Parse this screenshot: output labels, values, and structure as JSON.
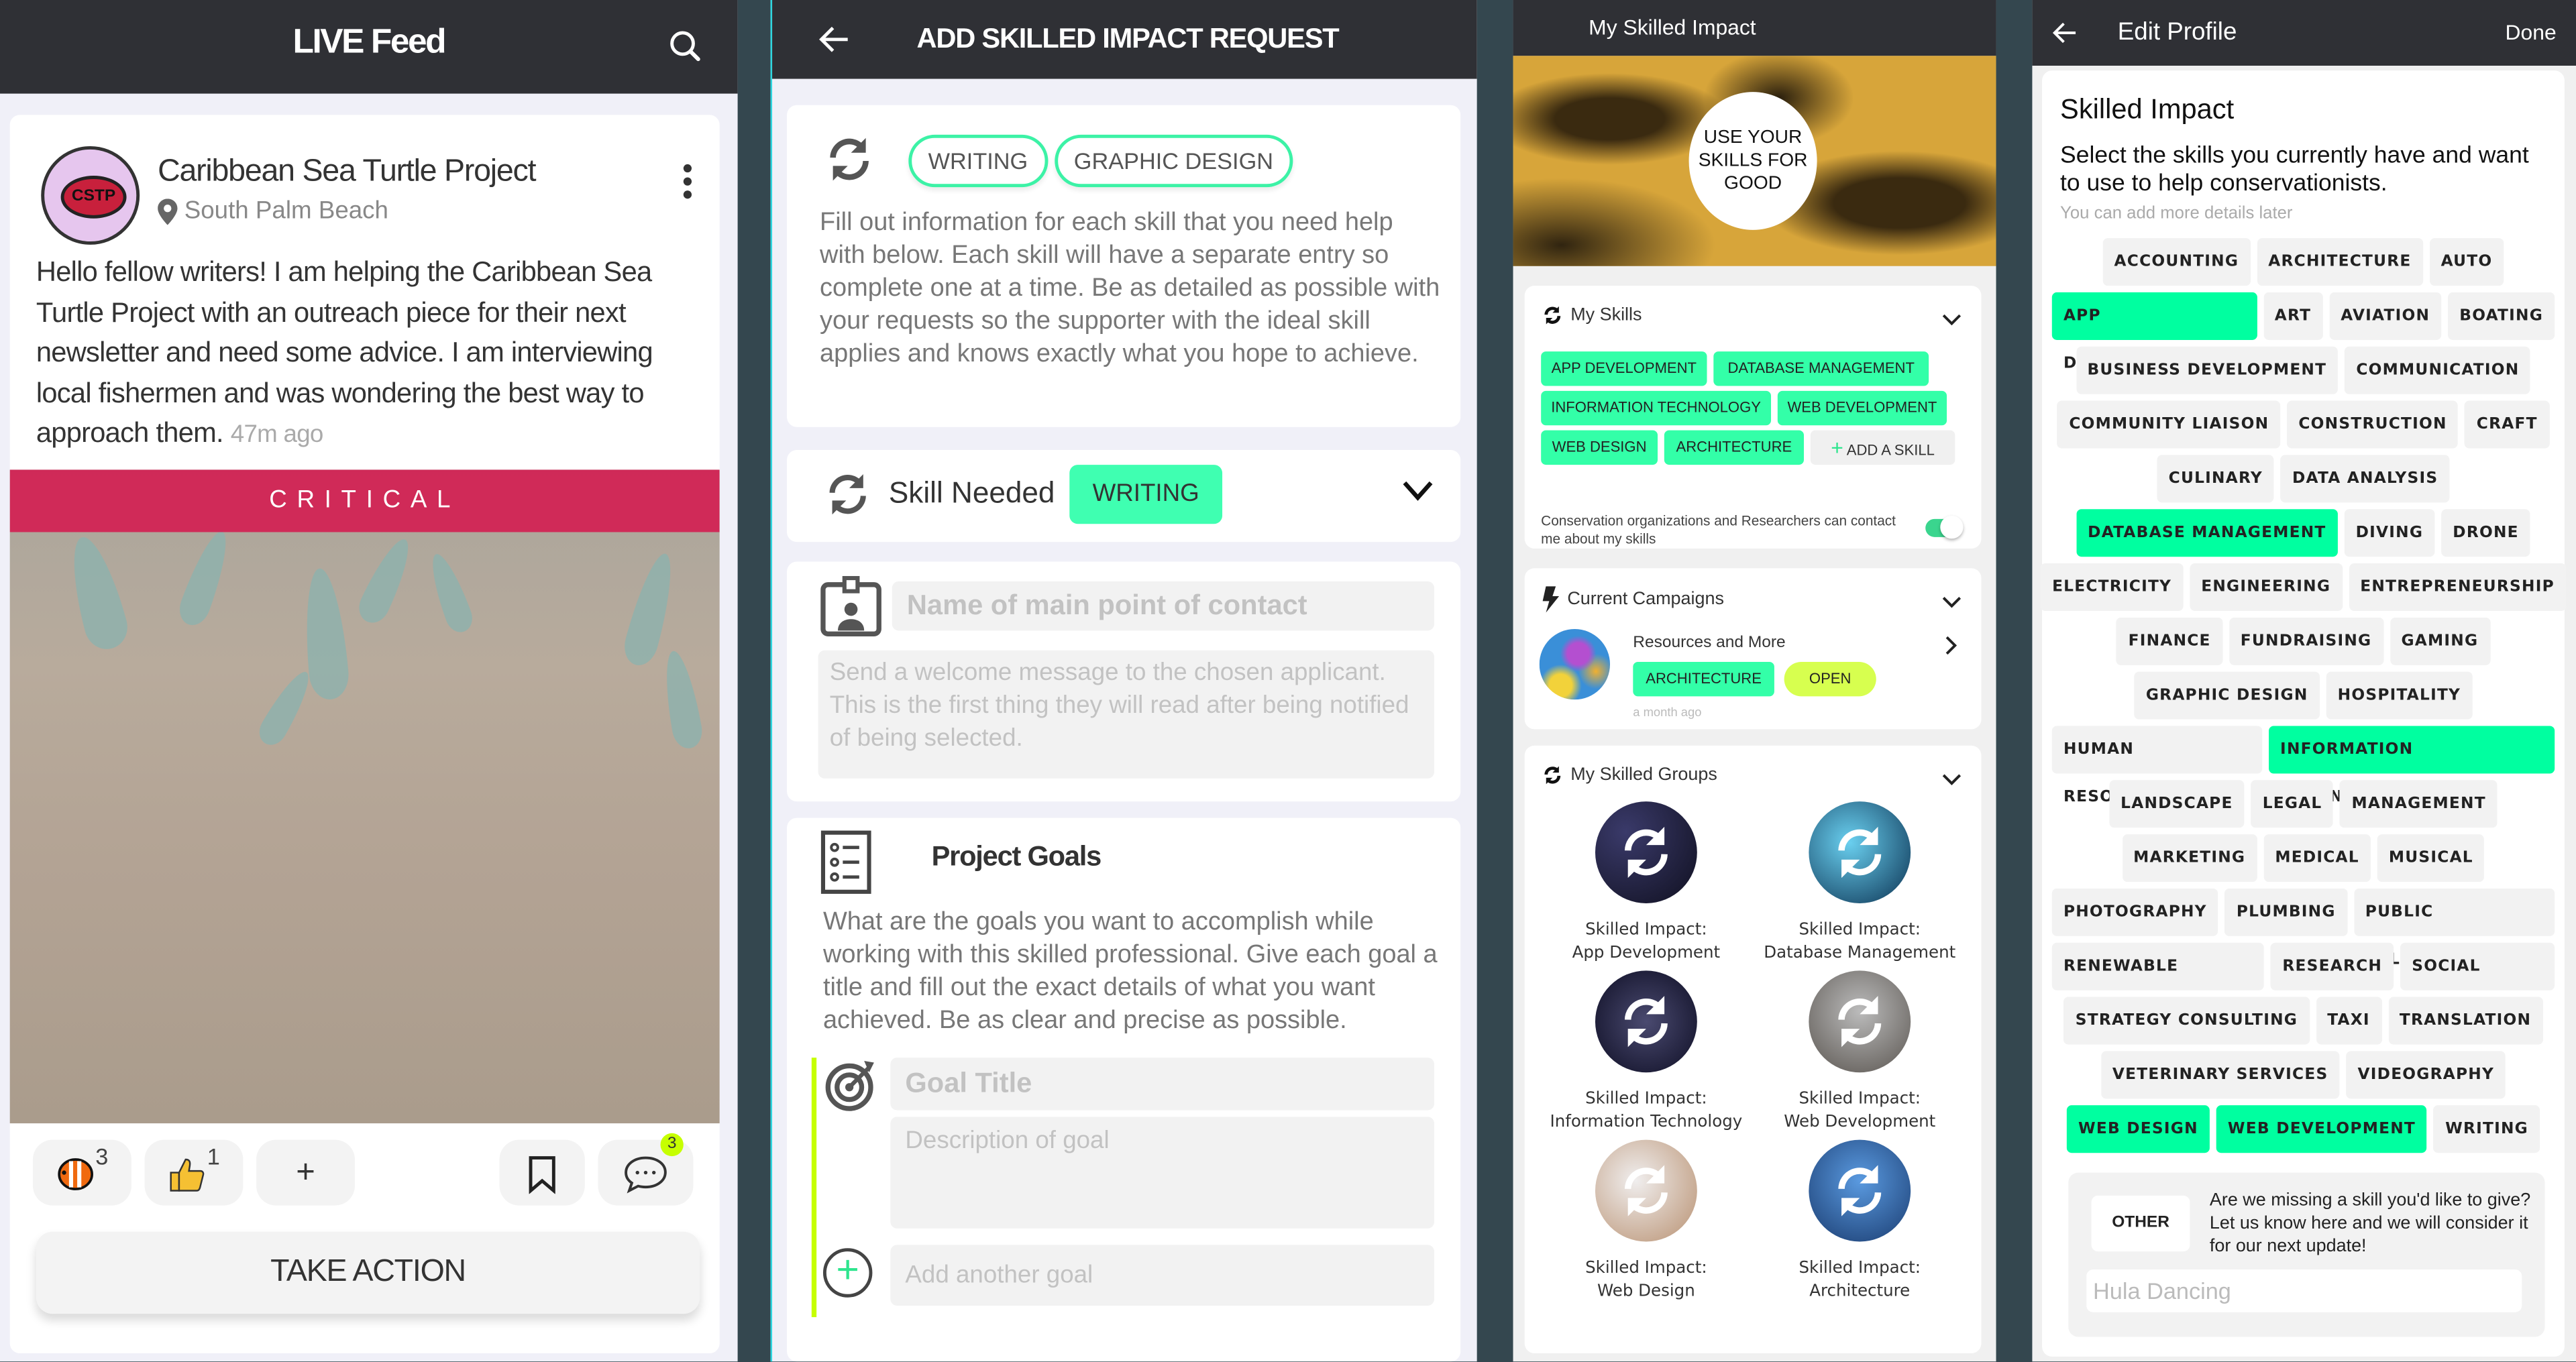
{
  "feed": {
    "title": "LIVE Feed",
    "post": {
      "org_name": "Caribbean Sea Turtle Project",
      "avatar_text": "CSTP",
      "location": "South Palm Beach",
      "body": "Hello fellow writers! I am helping the Caribbean Sea Turtle Project with an outreach piece for their next newsletter and need some advice. I am interviewing local fishermen and was wondering the best way to approach them.",
      "time_ago": "47m ago",
      "banner": "CRITICAL",
      "reactions": [
        {
          "icon": "clownfish-icon",
          "count": "3"
        },
        {
          "icon": "thumbs-up-icon",
          "count": "1"
        }
      ],
      "add_reaction": "+",
      "comment_count": "3",
      "action_button": "TAKE ACTION"
    }
  },
  "request": {
    "title": "ADD SKILLED IMPACT REQUEST",
    "selected_skills": [
      "WRITING",
      "GRAPHIC DESIGN"
    ],
    "intro": "Fill out information for each skill that you need help with below. Each skill will have a separate entry so complete one at a time. Be as detailed as possible with your requests so the supporter with the ideal skill applies and knows exactly what you hope to achieve.",
    "skill_needed_label": "Skill Needed",
    "skill_needed_value": "WRITING",
    "contact_placeholder": "Name of main point of contact",
    "welcome_placeholder": "Send a welcome message to the chosen applicant. This is the first thing they will read after being notified of being selected.",
    "goals_title": "Project Goals",
    "goals_desc": "What are the goals you want to accomplish while working with this skilled professional. Give each goal a title and fill out the exact details of what you want achieved. Be as clear and precise as possible.",
    "goal_title_placeholder": "Goal Title",
    "goal_desc_placeholder": "Description of goal",
    "add_goal_placeholder": "Add another goal"
  },
  "my_impact": {
    "title": "My Skilled Impact",
    "hero_text": "USE YOUR SKILLS FOR GOOD",
    "my_skills_title": "My Skills",
    "skills": [
      "APP DEVELOPMENT",
      "DATABASE MANAGEMENT",
      "INFORMATION TECHNOLOGY",
      "WEB DEVELOPMENT",
      "WEB DESIGN",
      "ARCHITECTURE"
    ],
    "add_skill": "ADD A SKILL",
    "contact_toggle_label": "Conservation organizations and Researchers can contact me about my skills",
    "contact_toggle_on": true,
    "campaigns_title": "Current Campaigns",
    "campaign": {
      "name": "Resources and More",
      "skill": "ARCHITECTURE",
      "status": "OPEN",
      "time_ago": "a month ago"
    },
    "groups_title": "My Skilled Groups",
    "groups": [
      {
        "line1": "Skilled Impact:",
        "line2": "App Development"
      },
      {
        "line1": "Skilled Impact:",
        "line2": "Database Management"
      },
      {
        "line1": "Skilled Impact:",
        "line2": "Information Technology"
      },
      {
        "line1": "Skilled Impact:",
        "line2": "Web Development"
      },
      {
        "line1": "Skilled Impact:",
        "line2": "Web Design"
      },
      {
        "line1": "Skilled Impact:",
        "line2": "Architecture"
      }
    ]
  },
  "edit_profile": {
    "title": "Edit Profile",
    "done": "Done",
    "heading": "Skilled Impact",
    "prompt": "Select the skills you currently have and want to use to help conservationists.",
    "hint": "You can add more details later",
    "skill_rows": [
      [
        {
          "label": "ACCOUNTING",
          "selected": false
        },
        {
          "label": "ARCHITECTURE",
          "selected": false
        },
        {
          "label": "AUTO",
          "selected": false
        }
      ],
      [
        {
          "label": "APP DEVELOPMENT",
          "selected": true
        },
        {
          "label": "ART",
          "selected": false
        },
        {
          "label": "AVIATION",
          "selected": false
        },
        {
          "label": "BOATING",
          "selected": false
        }
      ],
      [
        {
          "label": "BUSINESS DEVELOPMENT",
          "selected": false
        },
        {
          "label": "COMMUNICATION",
          "selected": false
        }
      ],
      [
        {
          "label": "COMMUNITY LIAISON",
          "selected": false
        },
        {
          "label": "CONSTRUCTION",
          "selected": false
        },
        {
          "label": "CRAFT",
          "selected": false
        }
      ],
      [
        {
          "label": "CULINARY",
          "selected": false
        },
        {
          "label": "DATA ANALYSIS",
          "selected": false
        }
      ],
      [
        {
          "label": "DATABASE MANAGEMENT",
          "selected": true
        },
        {
          "label": "DIVING",
          "selected": false
        },
        {
          "label": "DRONE",
          "selected": false
        }
      ],
      [
        {
          "label": "ELECTRICITY",
          "selected": false
        },
        {
          "label": "ENGINEERING",
          "selected": false
        },
        {
          "label": "ENTREPRENEURSHIP",
          "selected": false
        }
      ],
      [
        {
          "label": "FINANCE",
          "selected": false
        },
        {
          "label": "FUNDRAISING",
          "selected": false
        },
        {
          "label": "GAMING",
          "selected": false
        }
      ],
      [
        {
          "label": "GRAPHIC DESIGN",
          "selected": false
        },
        {
          "label": "HOSPITALITY",
          "selected": false
        }
      ],
      [
        {
          "label": "HUMAN RESOURCES",
          "selected": false
        },
        {
          "label": "INFORMATION TECHNOLOGY",
          "selected": true
        }
      ],
      [
        {
          "label": "LANDSCAPE",
          "selected": false
        },
        {
          "label": "LEGAL",
          "selected": false
        },
        {
          "label": "MANAGEMENT",
          "selected": false
        }
      ],
      [
        {
          "label": "MARKETING",
          "selected": false
        },
        {
          "label": "MEDICAL",
          "selected": false
        },
        {
          "label": "MUSICAL",
          "selected": false
        }
      ],
      [
        {
          "label": "PHOTOGRAPHY",
          "selected": false
        },
        {
          "label": "PLUMBING",
          "selected": false
        },
        {
          "label": "PUBLIC RELATIONS",
          "selected": false
        }
      ],
      [
        {
          "label": "RENEWABLE ENERGY",
          "selected": false
        },
        {
          "label": "RESEARCH",
          "selected": false
        },
        {
          "label": "SOCIAL MEDIA",
          "selected": false
        }
      ],
      [
        {
          "label": "STRATEGY CONSULTING",
          "selected": false
        },
        {
          "label": "TAXI",
          "selected": false
        },
        {
          "label": "TRANSLATION",
          "selected": false
        }
      ],
      [
        {
          "label": "VETERINARY SERVICES",
          "selected": false
        },
        {
          "label": "VIDEOGRAPHY",
          "selected": false
        }
      ],
      [
        {
          "label": "WEB DESIGN",
          "selected": true
        },
        {
          "label": "WEB DEVELOPMENT",
          "selected": true
        },
        {
          "label": "WRITING",
          "selected": false
        }
      ]
    ],
    "other_label": "OTHER",
    "other_prompt": "Are we missing a skill you'd like to give? Let us know here and we will consider it for our next update!",
    "other_placeholder": "Hula Dancing"
  },
  "colors": {
    "accent_green": "#3fffb1",
    "selected_green": "#00ffa0",
    "lime": "#c6ff00",
    "critical": "#d6144c",
    "topbar": "#2f3035",
    "divider": "#34474f"
  }
}
